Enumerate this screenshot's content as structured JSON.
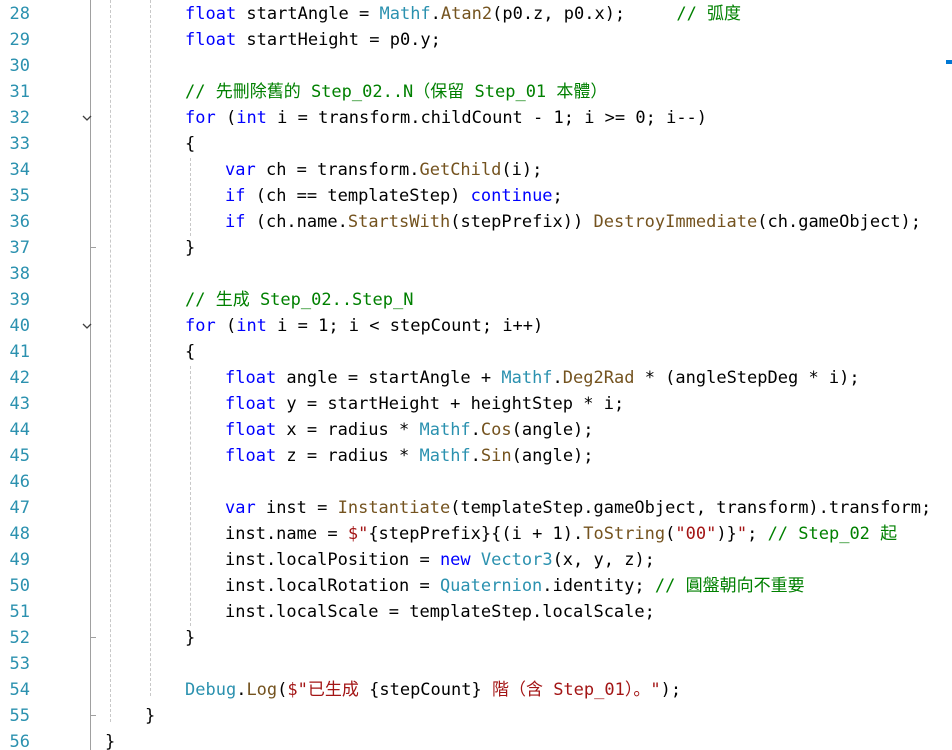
{
  "editor": {
    "lines": [
      {
        "n": "28",
        "indent": 2,
        "fold": false,
        "tokens": [
          [
            "kw",
            "float"
          ],
          [
            "",
            " startAngle = "
          ],
          [
            "ty",
            "Mathf"
          ],
          [
            "",
            "."
          ],
          [
            "fn",
            "Atan2"
          ],
          [
            "",
            "(p0.z, p0.x);     "
          ],
          [
            "cm",
            "// 弧度"
          ]
        ]
      },
      {
        "n": "29",
        "indent": 2,
        "fold": false,
        "tokens": [
          [
            "kw",
            "float"
          ],
          [
            "",
            " startHeight = p0.y;"
          ]
        ]
      },
      {
        "n": "30",
        "indent": 2,
        "fold": false,
        "tokens": []
      },
      {
        "n": "31",
        "indent": 2,
        "fold": false,
        "tokens": [
          [
            "cm",
            "// 先刪除舊的 Step_02..N（保留 Step_01 本體）"
          ]
        ]
      },
      {
        "n": "32",
        "indent": 2,
        "fold": true,
        "tokens": [
          [
            "kw",
            "for"
          ],
          [
            "",
            " ("
          ],
          [
            "kw",
            "int"
          ],
          [
            "",
            " i = transform.childCount - 1; i >= 0; i--)"
          ]
        ]
      },
      {
        "n": "33",
        "indent": 2,
        "fold": false,
        "tokens": [
          [
            "",
            "{"
          ]
        ]
      },
      {
        "n": "34",
        "indent": 3,
        "fold": false,
        "tokens": [
          [
            "kw",
            "var"
          ],
          [
            "",
            " ch = transform."
          ],
          [
            "fn",
            "GetChild"
          ],
          [
            "",
            "(i);"
          ]
        ]
      },
      {
        "n": "35",
        "indent": 3,
        "fold": false,
        "tokens": [
          [
            "kw",
            "if"
          ],
          [
            "",
            " (ch == templateStep) "
          ],
          [
            "kw",
            "continue"
          ],
          [
            "",
            ";"
          ]
        ]
      },
      {
        "n": "36",
        "indent": 3,
        "fold": false,
        "tokens": [
          [
            "kw",
            "if"
          ],
          [
            "",
            " (ch.name."
          ],
          [
            "fn",
            "StartsWith"
          ],
          [
            "",
            "(stepPrefix)) "
          ],
          [
            "fn",
            "DestroyImmediate"
          ],
          [
            "",
            "(ch.gameObject);"
          ]
        ]
      },
      {
        "n": "37",
        "indent": 2,
        "fold": false,
        "tokens": [
          [
            "",
            "}"
          ]
        ]
      },
      {
        "n": "38",
        "indent": 2,
        "fold": false,
        "tokens": []
      },
      {
        "n": "39",
        "indent": 2,
        "fold": false,
        "tokens": [
          [
            "cm",
            "// 生成 Step_02..Step_N"
          ]
        ]
      },
      {
        "n": "40",
        "indent": 2,
        "fold": true,
        "tokens": [
          [
            "kw",
            "for"
          ],
          [
            "",
            " ("
          ],
          [
            "kw",
            "int"
          ],
          [
            "",
            " i = 1; i < stepCount; i++)"
          ]
        ]
      },
      {
        "n": "41",
        "indent": 2,
        "fold": false,
        "tokens": [
          [
            "",
            "{"
          ]
        ]
      },
      {
        "n": "42",
        "indent": 3,
        "fold": false,
        "tokens": [
          [
            "kw",
            "float"
          ],
          [
            "",
            " angle = startAngle + "
          ],
          [
            "ty",
            "Mathf"
          ],
          [
            "",
            "."
          ],
          [
            "fn",
            "Deg2Rad"
          ],
          [
            "",
            " * (angleStepDeg * i);"
          ]
        ]
      },
      {
        "n": "43",
        "indent": 3,
        "fold": false,
        "tokens": [
          [
            "kw",
            "float"
          ],
          [
            "",
            " y = startHeight + heightStep * i;"
          ]
        ]
      },
      {
        "n": "44",
        "indent": 3,
        "fold": false,
        "tokens": [
          [
            "kw",
            "float"
          ],
          [
            "",
            " x = radius * "
          ],
          [
            "ty",
            "Mathf"
          ],
          [
            "",
            "."
          ],
          [
            "fn",
            "Cos"
          ],
          [
            "",
            "(angle);"
          ]
        ]
      },
      {
        "n": "45",
        "indent": 3,
        "fold": false,
        "tokens": [
          [
            "kw",
            "float"
          ],
          [
            "",
            " z = radius * "
          ],
          [
            "ty",
            "Mathf"
          ],
          [
            "",
            "."
          ],
          [
            "fn",
            "Sin"
          ],
          [
            "",
            "(angle);"
          ]
        ]
      },
      {
        "n": "46",
        "indent": 3,
        "fold": false,
        "tokens": []
      },
      {
        "n": "47",
        "indent": 3,
        "fold": false,
        "tokens": [
          [
            "kw",
            "var"
          ],
          [
            "",
            " inst = "
          ],
          [
            "fn",
            "Instantiate"
          ],
          [
            "",
            "(templateStep.gameObject, transform).transform;"
          ]
        ]
      },
      {
        "n": "48",
        "indent": 3,
        "fold": false,
        "tokens": [
          [
            "",
            "inst.name = "
          ],
          [
            "st",
            "$\""
          ],
          [
            "",
            "{stepPrefix}{(i + 1)."
          ],
          [
            "fn",
            "ToString"
          ],
          [
            "",
            "("
          ],
          [
            "st",
            "\"00\""
          ],
          [
            "",
            ")}"
          ],
          [
            "st",
            "\""
          ],
          [
            "",
            "; "
          ],
          [
            "cm",
            "// Step_02 起"
          ]
        ]
      },
      {
        "n": "49",
        "indent": 3,
        "fold": false,
        "tokens": [
          [
            "",
            "inst.localPosition = "
          ],
          [
            "kw",
            "new"
          ],
          [
            "",
            " "
          ],
          [
            "ty",
            "Vector3"
          ],
          [
            "",
            "(x, y, z);"
          ]
        ]
      },
      {
        "n": "50",
        "indent": 3,
        "fold": false,
        "tokens": [
          [
            "",
            "inst.localRotation = "
          ],
          [
            "ty",
            "Quaternion"
          ],
          [
            "",
            ".identity; "
          ],
          [
            "cm",
            "// 圓盤朝向不重要"
          ]
        ]
      },
      {
        "n": "51",
        "indent": 3,
        "fold": false,
        "tokens": [
          [
            "",
            "inst.localScale = templateStep.localScale;"
          ]
        ]
      },
      {
        "n": "52",
        "indent": 2,
        "fold": false,
        "tokens": [
          [
            "",
            "}"
          ]
        ]
      },
      {
        "n": "53",
        "indent": 2,
        "fold": false,
        "tokens": []
      },
      {
        "n": "54",
        "indent": 2,
        "fold": false,
        "tokens": [
          [
            "ty",
            "Debug"
          ],
          [
            "",
            "."
          ],
          [
            "fn",
            "Log"
          ],
          [
            "",
            "("
          ],
          [
            "st",
            "$\"已生成 "
          ],
          [
            "",
            "{stepCount}"
          ],
          [
            "st",
            " 階（含 Step_01）。\""
          ],
          [
            "",
            ");"
          ]
        ]
      },
      {
        "n": "55",
        "indent": 1,
        "fold": false,
        "tokens": [
          [
            "",
            "}"
          ]
        ]
      },
      {
        "n": "56",
        "indent": 0,
        "fold": false,
        "tokens": [
          [
            "",
            "}"
          ]
        ]
      }
    ]
  }
}
